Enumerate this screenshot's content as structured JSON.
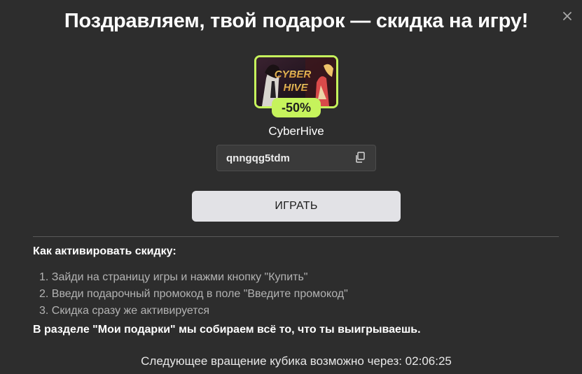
{
  "title": "Поздравляем, твой подарок — скидка на игру!",
  "close": {
    "icon": "close-icon"
  },
  "game": {
    "name": "CyberHive",
    "cover_text": "CYBER HIVE",
    "discount": "-50%"
  },
  "promo": {
    "code": "qnngqg5tdm",
    "copy_icon": "copy-icon"
  },
  "play_button": "ИГРАТЬ",
  "instructions": {
    "title": "Как активировать скидку:",
    "steps": [
      "1. Зайди на страницу игры и нажми кнопку \"Купить\"",
      "2. Введи подарочный промокод в поле \"Введите промокод\"",
      "3. Скидка сразу же активируется"
    ],
    "note": "В разделе \"Мои подарки\" мы собираем всё то, что ты выигрываешь."
  },
  "next_spin": "Следующее вращение кубика возможно через: 02:06:25",
  "colors": {
    "background": "#2d2d2d",
    "accent": "#c6f35c",
    "button_bg": "#e2e2e6",
    "muted_text": "#b3b3b3"
  }
}
